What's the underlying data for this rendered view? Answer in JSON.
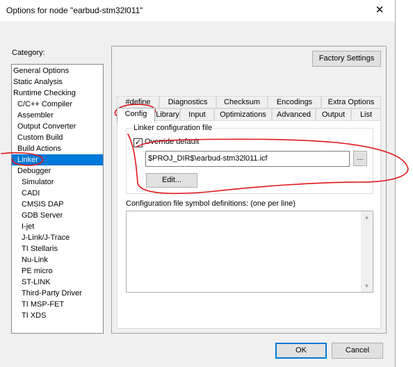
{
  "window": {
    "title": "Options for node \"earbud-stm32l011\"",
    "close_glyph": "✕"
  },
  "category": {
    "label": "Category:",
    "items": [
      {
        "label": "General Options",
        "level": 0
      },
      {
        "label": "Static Analysis",
        "level": 0
      },
      {
        "label": "Runtime Checking",
        "level": 0
      },
      {
        "label": "C/C++ Compiler",
        "level": 1
      },
      {
        "label": "Assembler",
        "level": 1
      },
      {
        "label": "Output Converter",
        "level": 1
      },
      {
        "label": "Custom Build",
        "level": 1
      },
      {
        "label": "Build Actions",
        "level": 1
      },
      {
        "label": "Linker",
        "level": 1,
        "selected": true
      },
      {
        "label": "Debugger",
        "level": 1
      },
      {
        "label": "Simulator",
        "level": 2
      },
      {
        "label": "CADI",
        "level": 2
      },
      {
        "label": "CMSIS DAP",
        "level": 2
      },
      {
        "label": "GDB Server",
        "level": 2
      },
      {
        "label": "I-jet",
        "level": 2
      },
      {
        "label": "J-Link/J-Trace",
        "level": 2
      },
      {
        "label": "TI Stellaris",
        "level": 2
      },
      {
        "label": "Nu-Link",
        "level": 2
      },
      {
        "label": "PE micro",
        "level": 2
      },
      {
        "label": "ST-LINK",
        "level": 2
      },
      {
        "label": "Third-Party Driver",
        "level": 2
      },
      {
        "label": "TI MSP-FET",
        "level": 2
      },
      {
        "label": "TI XDS",
        "level": 2
      }
    ]
  },
  "factory_settings": "Factory Settings",
  "tabs": {
    "row1": [
      "#define",
      "Diagnostics",
      "Checksum",
      "Encodings",
      "Extra Options"
    ],
    "row2": [
      "Config",
      "Library",
      "Input",
      "Optimizations",
      "Advanced",
      "Output",
      "List"
    ],
    "active": "Config"
  },
  "config": {
    "group_title": "Linker configuration file",
    "override_label": "Override default",
    "override_checked": true,
    "check_glyph": "✓",
    "path_value": "$PROJ_DIR$\\earbud-stm32l011.icf",
    "browse_label": "...",
    "edit_label": "Edit...",
    "symbols_label": "Configuration file symbol definitions: (one per line)",
    "symbols_value": "",
    "scroll_up": "▲",
    "scroll_down": "▼"
  },
  "buttons": {
    "ok": "OK",
    "cancel": "Cancel"
  },
  "colors": {
    "selection": "#0078d7",
    "annotation_ink": "#e0161a"
  }
}
